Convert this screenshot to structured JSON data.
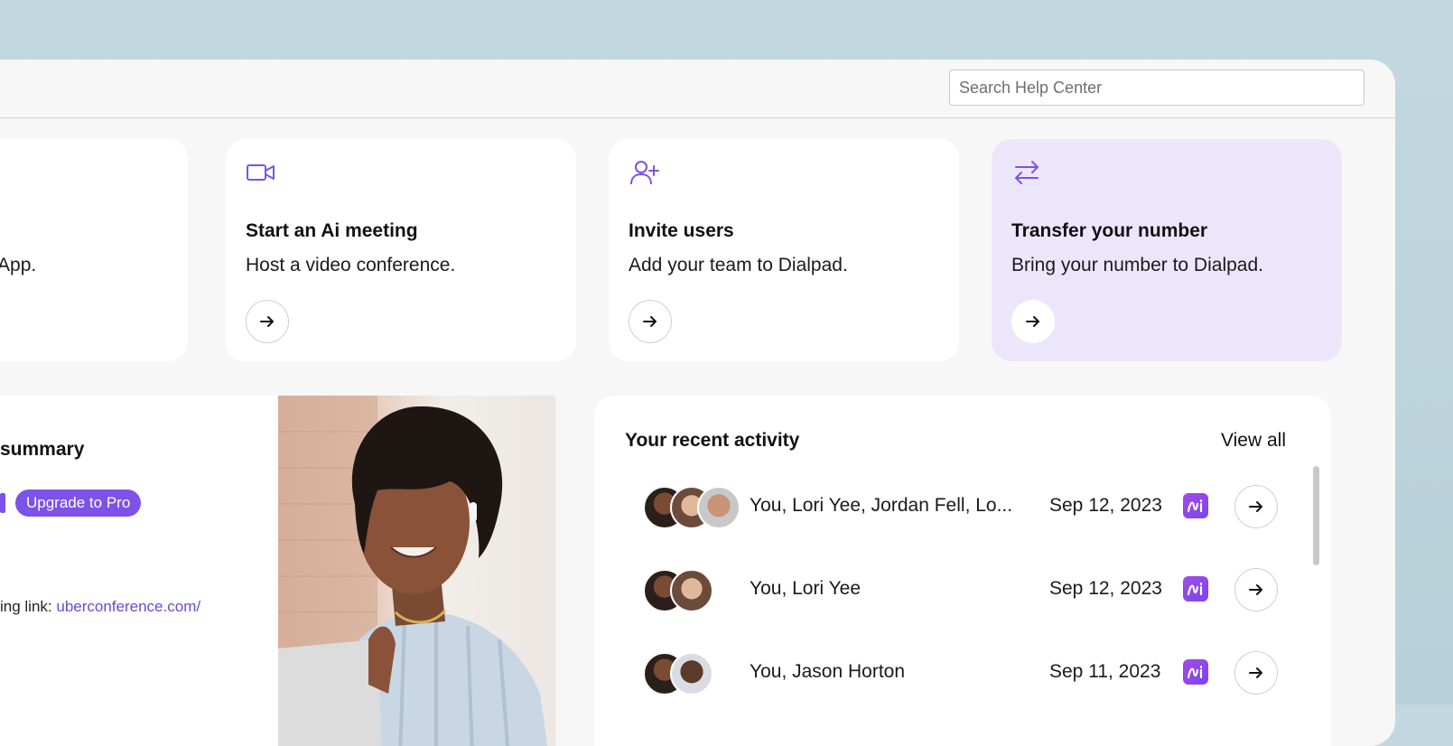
{
  "search": {
    "placeholder": "Search Help Center"
  },
  "cards": [
    {
      "icon": "download-icon",
      "title": "",
      "desc": "ad App."
    },
    {
      "icon": "video-icon",
      "title": "Start an Ai meeting",
      "desc": "Host a video conference."
    },
    {
      "icon": "add-user-icon",
      "title": "Invite users",
      "desc": "Add your team to Dialpad."
    },
    {
      "icon": "transfer-icon",
      "title": "Transfer your number",
      "desc": "Bring your number to Dialpad."
    }
  ],
  "summary": {
    "title": "summary",
    "upgrade_label": "Upgrade to Pro",
    "meeting_link_label": "ing link: ",
    "meeting_link_url": "uberconference.com/"
  },
  "activity": {
    "title": "Your recent activity",
    "view_all": "View all",
    "rows": [
      {
        "names": "You, Lori Yee, Jordan Fell, Lo...",
        "date": "Sep 12, 2023",
        "badge": "Ai"
      },
      {
        "names": "You, Lori Yee",
        "date": "Sep 12, 2023",
        "badge": "Ai"
      },
      {
        "names": "You, Jason Horton",
        "date": "Sep 11, 2023",
        "badge": "Ai"
      }
    ]
  },
  "colors": {
    "accent": "#7c52e8",
    "highlight_card": "#ece6fb",
    "background": "#bdd4dc"
  }
}
